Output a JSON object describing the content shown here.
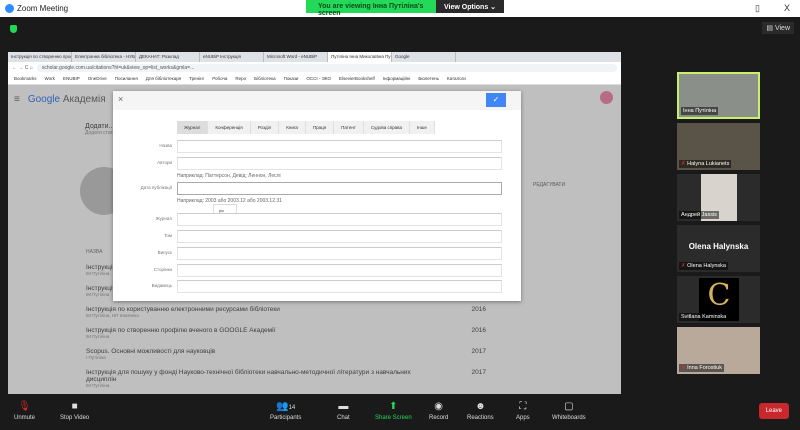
{
  "window": {
    "title": "Zoom Meeting",
    "minimize": "▯",
    "close": "X"
  },
  "banner": {
    "text": "You are viewing Інна Путіліна's screen",
    "view_options": "View Options ⌄"
  },
  "view_button": "▤ View",
  "browser": {
    "tabs": [
      "Інструкція по створенню проф",
      "Електронна бібліотека - НУБіП",
      "ДЕКАНАТ: Розклад",
      "eNUBiP Інструкція",
      "Microsoft Word - eNUBiP",
      "Путіліна Інна Миколаївна Пуб",
      "Google"
    ],
    "url": "scholar.google.com.ua/citations?hl=uk&view_op=list_works&gmla=...",
    "bookmarks": [
      "Bookmarks",
      "Work",
      "ENUBIP",
      "OneDrive",
      "Посилання",
      "Для бібліотекаря",
      "Тренінг",
      "Робоча",
      "Repo",
      "Бібліотека",
      "Покази",
      "ОССІ - ЭКО",
      "ElsevierBookshelf",
      "Інформаційні",
      "Бюлетень",
      "Каталоги"
    ]
  },
  "scholar": {
    "logo_google": "Google",
    "logo_rest": " Академія",
    "card_title": "Додати...",
    "card_sub": "Додати статті",
    "list_header": "НАЗВА",
    "items": [
      {
        "title": "Інструкція...",
        "authors": "ІМ Путіліна",
        "year": ""
      },
      {
        "title": "Інструкція...",
        "authors": "ІМ Путіліна",
        "year": ""
      },
      {
        "title": "Інструкція по користуванню електронними ресурсами бібліотеки",
        "authors": "ІМ Путіліна, НП Ігнатенко",
        "year": "2016"
      },
      {
        "title": "Інструкція по створенню профілю вченого в GOOGLE Академії",
        "authors": "ІМ Путіліна",
        "year": "2016"
      },
      {
        "title": "Scopus. Основні можливості для науковців",
        "authors": "І Путіліна",
        "year": "2017"
      },
      {
        "title": "Інструкція для пошуку у фонді Науково-технічної бібліотеки навчально-методичної літератури з навчальних дисциплін",
        "authors": "ІМ Путіліна",
        "year": "2017"
      }
    ],
    "edit_link": "РЕДАГУВАТИ"
  },
  "dialog": {
    "close": "×",
    "confirm": "✓",
    "tabs": [
      "Журнал",
      "Конференція",
      "Розділ",
      "Книга",
      "Праця",
      "Патент",
      "Судова справа",
      "Інше"
    ],
    "fields": {
      "title": "Назва",
      "authors": "Автори",
      "date": "Дата публікації",
      "journal": "Журнал",
      "volume": "Том",
      "issue": "Випуск",
      "pages": "Сторінки",
      "publisher": "Видавець"
    },
    "authors_hint": "Наприклад: Паттерсон, Девід; Леннон, Леслі",
    "date_hint": "Наприклад: 2003 або 2003.12 або 2003.12.31",
    "tooltip": "рік"
  },
  "participants": [
    {
      "name": "Інна Путіліна",
      "muted": false,
      "speaking": true
    },
    {
      "name": "Halyna Lukianets",
      "muted": true
    },
    {
      "name": "Андрей Jassis",
      "muted": false
    },
    {
      "name": "Olena Halynska",
      "muted": true,
      "display": "Olena Halynska"
    },
    {
      "name": "Svitlana Kaminska",
      "muted": false
    },
    {
      "name": "Inna Forostiuk",
      "muted": true
    }
  ],
  "toolbar": {
    "unmute": "Unmute",
    "stop_video": "Stop Video",
    "participants": "Participants",
    "participant_count": "14",
    "chat": "Chat",
    "share": "Share Screen",
    "record": "Record",
    "reactions": "Reactions",
    "apps": "Apps",
    "whiteboards": "Whiteboards",
    "leave": "Leave"
  }
}
